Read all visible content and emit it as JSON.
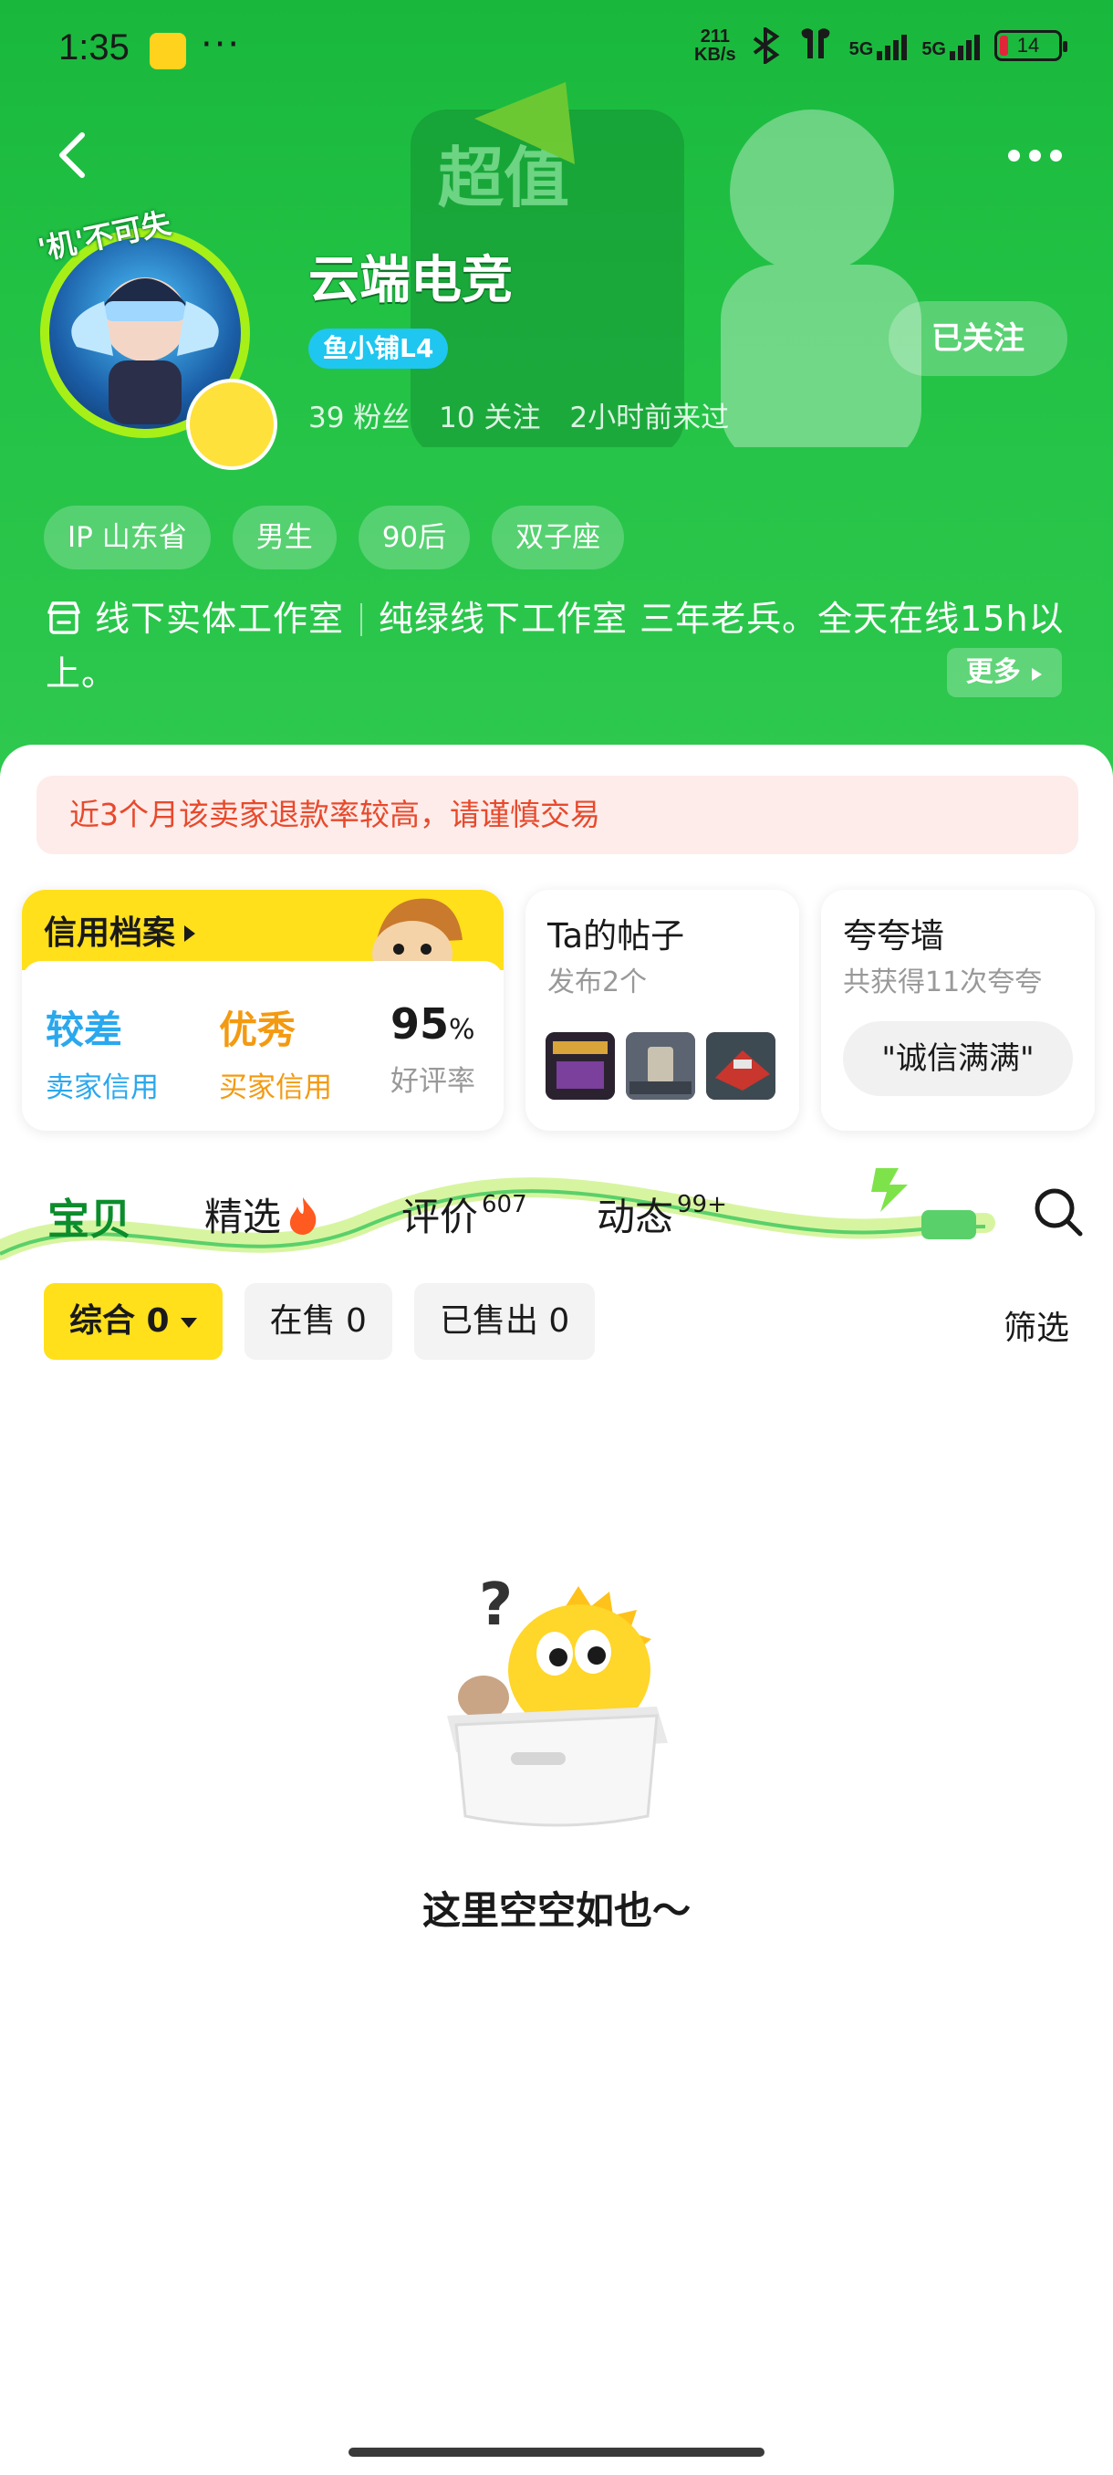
{
  "status_bar": {
    "time": "1:35",
    "speed_value": "211",
    "speed_unit": "KB/s",
    "net1": "5G",
    "net2": "5G",
    "battery": "14"
  },
  "profile": {
    "avatar_badge": "'机'不可失",
    "name": "云端电竞",
    "level_badge": "鱼小铺L4",
    "fans": "39 粉丝",
    "following": "10 关注",
    "last_seen": "2小时前来过",
    "follow_label": "已关注",
    "banner_text": "超值",
    "tags": [
      "IP 山东省",
      "男生",
      "90后",
      "双子座"
    ],
    "desc_part1": "线下实体工作室",
    "desc_part2": "纯绿线下工作室  三年老兵。全天在线15h以上。",
    "more_label": "更多"
  },
  "warning": "近3个月该卖家退款率较高，请谨慎交易",
  "credit": {
    "title": "信用档案",
    "seller_credit_value": "较差",
    "seller_credit_label": "卖家信用",
    "buyer_credit_value": "优秀",
    "buyer_credit_label": "买家信用",
    "rating_value": "95",
    "rating_unit": "%",
    "rating_label": "好评率"
  },
  "posts": {
    "title": "Ta的帖子",
    "subtitle": "发布2个"
  },
  "wall": {
    "title": "夸夸墙",
    "subtitle": "共获得11次夸夸",
    "praise": "\"诚信满满\""
  },
  "tabs": {
    "items": [
      {
        "label": "宝贝",
        "badge": ""
      },
      {
        "label": "精选",
        "badge": ""
      },
      {
        "label": "评价",
        "badge": "607"
      },
      {
        "label": "动态",
        "badge": "99+"
      }
    ]
  },
  "filters": {
    "chips": [
      "综合 0",
      "在售 0",
      "已售出 0"
    ],
    "filter_label": "筛选"
  },
  "empty_text": "这里空空如也～",
  "colors": {
    "brand_green": "#22c245",
    "accent_yellow": "#ffe01b",
    "warning_red": "#e8492c",
    "seller_credit_blue": "#2aa8ee",
    "buyer_credit_orange": "#f39a11"
  }
}
